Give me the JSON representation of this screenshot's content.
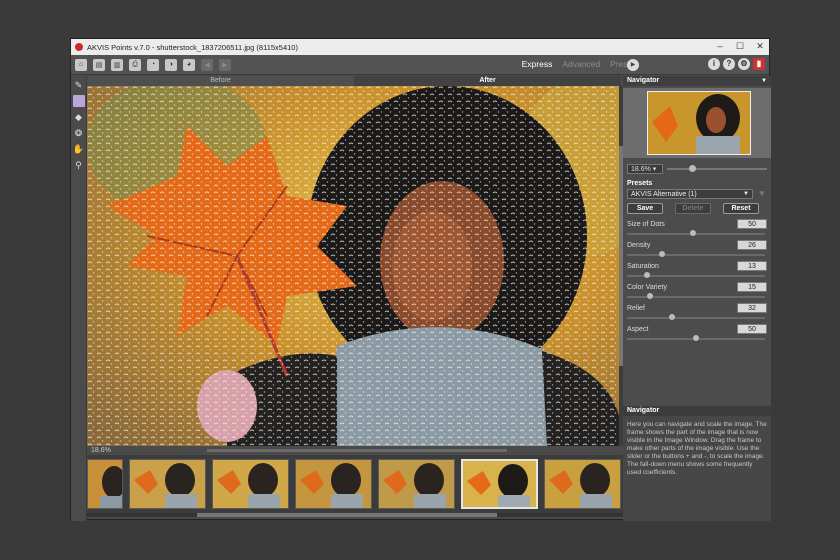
{
  "window": {
    "title": "AKVIS Points v.7.0 - shutterstock_1837206511.jpg (8115x5410)"
  },
  "toolbar": {
    "modes": [
      {
        "label": "Express",
        "active": true
      },
      {
        "label": "Advanced",
        "active": false
      },
      {
        "label": "Presets",
        "active": false
      }
    ]
  },
  "view_tabs": {
    "before": "Before",
    "after": "After"
  },
  "zoom_level": "18.6%",
  "navigator": {
    "title": "Navigator",
    "zoom": "18.6%"
  },
  "presets": {
    "section": "Presets",
    "selected": "AKVIS Alternative (1)",
    "save": "Save",
    "delete": "Delete",
    "reset": "Reset"
  },
  "params": [
    {
      "label": "Size of Dots",
      "value": "50",
      "fraction": 0.48
    },
    {
      "label": "Density",
      "value": "26",
      "fraction": 0.24
    },
    {
      "label": "Saturation",
      "value": "13",
      "fraction": 0.13
    },
    {
      "label": "Color Variety",
      "value": "15",
      "fraction": 0.15
    },
    {
      "label": "Relief",
      "value": "32",
      "fraction": 0.32
    },
    {
      "label": "Aspect",
      "value": "50",
      "fraction": 0.5
    }
  ],
  "help": {
    "title": "Navigator",
    "text": "Here you can navigate and scale the image. The frame shows the part of the image that is now visible in the Image Window. Drag the frame to make other parts of the image visible. Use the slider or the buttons + and -, to scale the image. The fall-down menu shows some frequently used coefficients."
  },
  "filmstrip": {
    "count": 7,
    "selected_index": 5
  },
  "colors": {
    "accent_selected_tool": "#b9a6d9",
    "app_logo": "#cc2a2a"
  }
}
